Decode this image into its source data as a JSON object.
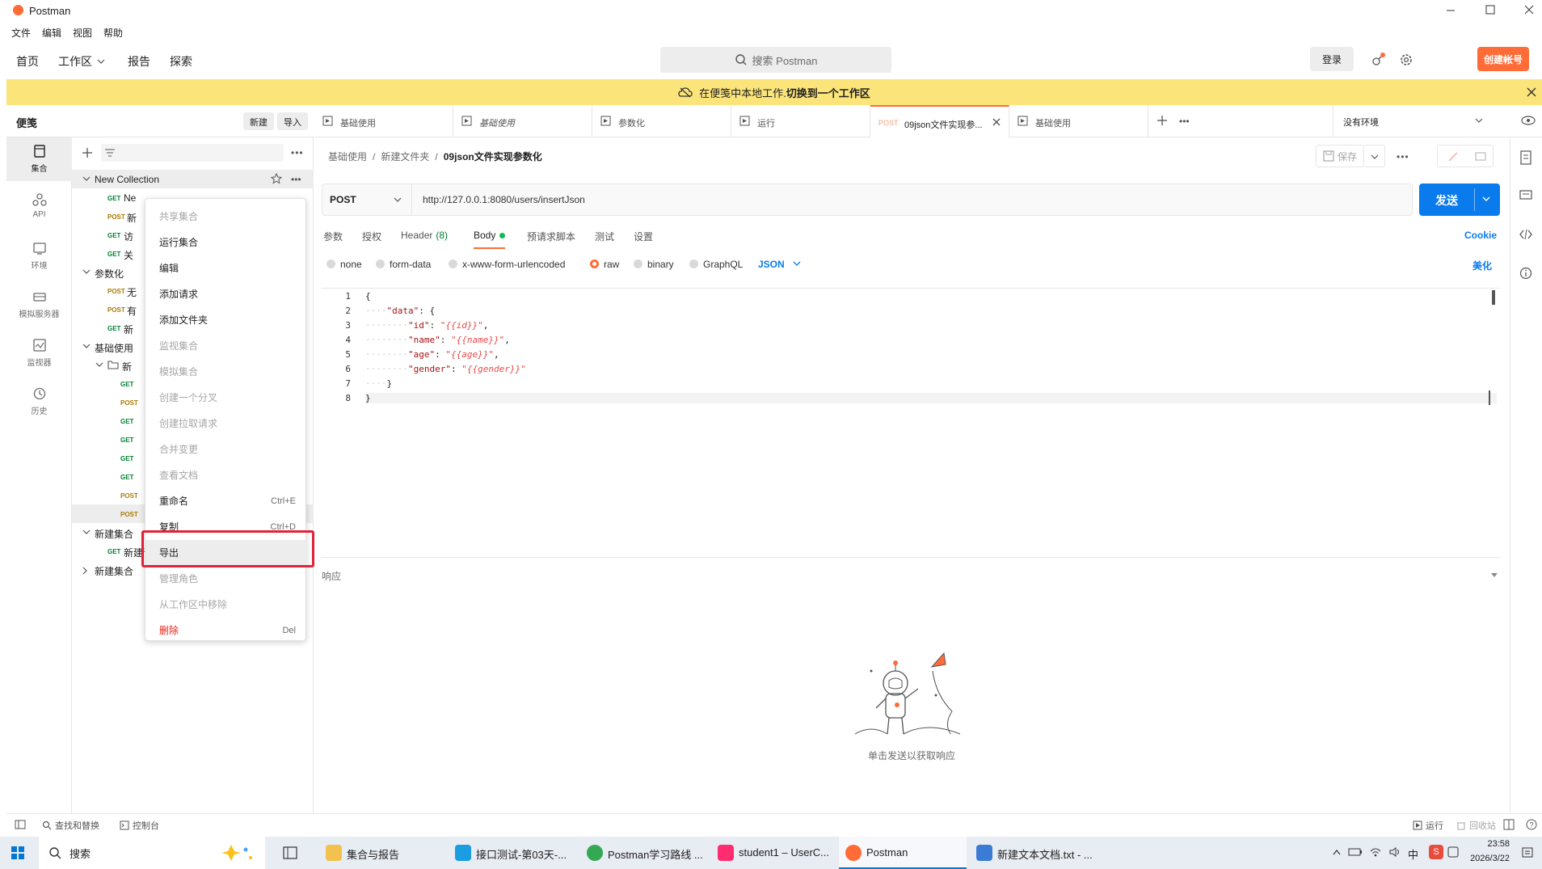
{
  "window": {
    "title": "Postman"
  },
  "menubar": [
    "文件",
    "编辑",
    "视图",
    "帮助"
  ],
  "header": {
    "nav": [
      "首页",
      "工作区",
      "报告",
      "探索"
    ],
    "search_placeholder": "搜索 Postman",
    "login": "登录",
    "signup": "创建帐号"
  },
  "banner": {
    "text": "在便笺中本地工作. ",
    "link": "切换到一个工作区"
  },
  "rail": [
    "集合",
    "API",
    "环境",
    "模拟服务器",
    "监视器",
    "历史"
  ],
  "sidebar": {
    "title": "便笺",
    "new_btn": "新建",
    "import_btn": "导入",
    "tree": [
      {
        "type": "folder",
        "label": "New Collection",
        "indent": 0,
        "open": true
      },
      {
        "type": "req",
        "method": "GET",
        "label": "Ne",
        "indent": 1
      },
      {
        "type": "req",
        "method": "POST",
        "label": "新",
        "indent": 1
      },
      {
        "type": "req",
        "method": "GET",
        "label": "访",
        "indent": 1
      },
      {
        "type": "req",
        "method": "GET",
        "label": "关",
        "indent": 1
      },
      {
        "type": "folder",
        "label": "参数化",
        "indent": 0,
        "open": true
      },
      {
        "type": "req",
        "method": "POST",
        "label": "无",
        "indent": 1
      },
      {
        "type": "req",
        "method": "POST",
        "label": "有",
        "indent": 1
      },
      {
        "type": "req",
        "method": "GET",
        "label": "新",
        "indent": 1
      },
      {
        "type": "folder",
        "label": "基础使用",
        "indent": 0,
        "open": true
      },
      {
        "type": "subfolder",
        "label": "新",
        "indent": 1,
        "open": true
      },
      {
        "type": "req",
        "method": "GET",
        "label": "",
        "indent": 2
      },
      {
        "type": "req",
        "method": "POST",
        "label": "",
        "indent": 2
      },
      {
        "type": "req",
        "method": "GET",
        "label": "",
        "indent": 2
      },
      {
        "type": "req",
        "method": "GET",
        "label": "",
        "indent": 2
      },
      {
        "type": "req",
        "method": "GET",
        "label": "",
        "indent": 2
      },
      {
        "type": "req",
        "method": "GET",
        "label": "",
        "indent": 2
      },
      {
        "type": "req",
        "method": "POST",
        "label": "",
        "indent": 2
      },
      {
        "type": "req",
        "method": "POST",
        "label": "",
        "indent": 2,
        "selected": true
      },
      {
        "type": "folder",
        "label": "新建集合",
        "indent": 0,
        "open": true
      },
      {
        "type": "req",
        "method": "GET",
        "label": "新建请求",
        "indent": 1
      },
      {
        "type": "folder",
        "label": "新建集合",
        "indent": 0,
        "open": false
      }
    ]
  },
  "context_menu": [
    {
      "label": "共享集合",
      "disabled": true,
      "shortcut": ""
    },
    {
      "label": "运行集合",
      "disabled": false,
      "shortcut": ""
    },
    {
      "label": "编辑",
      "disabled": false,
      "shortcut": ""
    },
    {
      "label": "添加请求",
      "disabled": false,
      "shortcut": ""
    },
    {
      "label": "添加文件夹",
      "disabled": false,
      "shortcut": ""
    },
    {
      "label": "监视集合",
      "disabled": true,
      "shortcut": ""
    },
    {
      "label": "模拟集合",
      "disabled": true,
      "shortcut": ""
    },
    {
      "label": "创建一个分叉",
      "disabled": true,
      "shortcut": ""
    },
    {
      "label": "创建拉取请求",
      "disabled": true,
      "shortcut": ""
    },
    {
      "label": "合并变更",
      "disabled": true,
      "shortcut": ""
    },
    {
      "label": "查看文档",
      "disabled": true,
      "shortcut": ""
    },
    {
      "label": "重命名",
      "disabled": false,
      "shortcut": "Ctrl+E"
    },
    {
      "label": "复制",
      "disabled": false,
      "shortcut": "Ctrl+D"
    },
    {
      "label": "导出",
      "disabled": false,
      "shortcut": "",
      "highlight": true
    },
    {
      "label": "管理角色",
      "disabled": true,
      "shortcut": ""
    },
    {
      "label": "从工作区中移除",
      "disabled": true,
      "shortcut": ""
    },
    {
      "label": "删除",
      "disabled": false,
      "shortcut": "Del",
      "danger": true
    }
  ],
  "tabs": [
    {
      "label": "基础使用",
      "method": "",
      "italic": false
    },
    {
      "label": "基础使用",
      "method": "",
      "italic": true
    },
    {
      "label": "参数化",
      "method": "",
      "italic": false
    },
    {
      "label": "运行",
      "method": "",
      "italic": false
    },
    {
      "label": "09json文件实现参...",
      "method": "POST",
      "italic": false,
      "active": true
    },
    {
      "label": "基础使用",
      "method": "",
      "italic": false
    }
  ],
  "environment": "没有环境",
  "request": {
    "breadcrumb": [
      "基础使用",
      "新建文件夹",
      "09json文件实现参数化"
    ],
    "save": "保存",
    "method": "POST",
    "url": "http://127.0.0.1:8080/users/insertJson",
    "send": "发送",
    "tabs": [
      "参数",
      "授权",
      "Header",
      "Body",
      "预请求脚本",
      "测试",
      "设置"
    ],
    "header_count": "(8)",
    "cookie": "Cookie",
    "body_types": [
      "none",
      "form-data",
      "x-www-form-urlencoded",
      "raw",
      "binary",
      "GraphQL"
    ],
    "body_format": "JSON",
    "beautify": "美化",
    "code_lines": [
      "1",
      "2",
      "3",
      "4",
      "5",
      "6",
      "7",
      "8"
    ]
  },
  "response": {
    "title": "响应",
    "hint": "单击发送以获取响应"
  },
  "statusbar": {
    "find": "查找和替换",
    "console": "控制台",
    "runner": "运行",
    "trash": "回收站"
  },
  "taskbar": {
    "search": "搜索",
    "apps": [
      "集合与报告",
      "接口测试-第03天-...",
      "Postman学习路线 ...",
      "student1 – UserC...",
      "Postman",
      "新建文本文档.txt - ..."
    ],
    "ime": "中",
    "time": "23:58",
    "date": "2026/3/22"
  },
  "colors": {
    "accent": "#ff6c37",
    "send": "#097bed",
    "banner": "#fbe47a",
    "highlight_box": "#e0223a"
  }
}
